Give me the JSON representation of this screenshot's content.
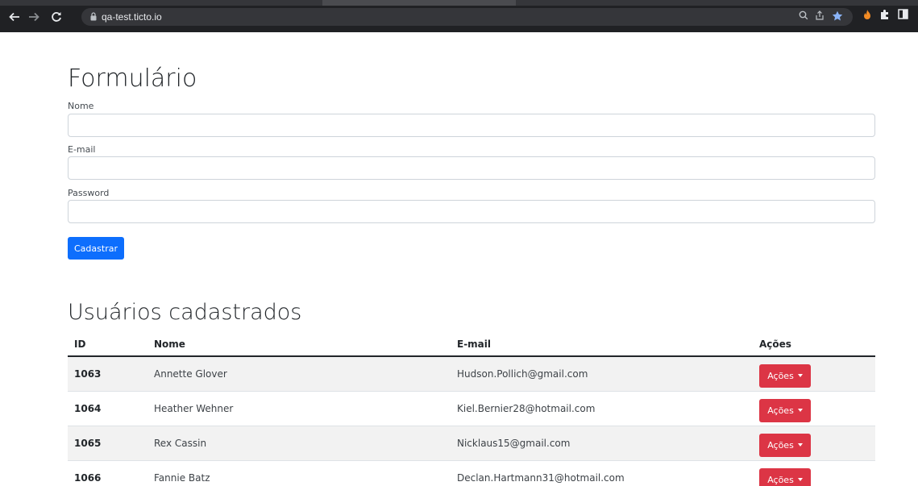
{
  "browser": {
    "url": "qa-test.ticto.io",
    "back_icon": "arrow-left-icon",
    "forward_icon": "arrow-right-icon",
    "reload_icon": "reload-icon"
  },
  "form": {
    "title": "Formulário",
    "name_label": "Nome",
    "name_value": "",
    "email_label": "E-mail",
    "email_value": "",
    "password_label": "Password",
    "password_value": "",
    "submit_label": "Cadastrar"
  },
  "users": {
    "title": "Usuários cadastrados",
    "columns": [
      "ID",
      "Nome",
      "E-mail",
      "Ações"
    ],
    "rows": [
      {
        "id": "1063",
        "name": "Annette Glover",
        "email": "Hudson.Pollich@gmail.com",
        "action": "Ações"
      },
      {
        "id": "1064",
        "name": "Heather Wehner",
        "email": "Kiel.Bernier28@hotmail.com",
        "action": "Ações"
      },
      {
        "id": "1065",
        "name": "Rex Cassin",
        "email": "Nicklaus15@gmail.com",
        "action": "Ações"
      },
      {
        "id": "1066",
        "name": "Fannie Batz",
        "email": "Declan.Hartmann31@hotmail.com",
        "action": "Ações"
      }
    ]
  },
  "colors": {
    "primary": "#0d6efd",
    "danger": "#dc3545",
    "chrome_bg": "#202124"
  }
}
